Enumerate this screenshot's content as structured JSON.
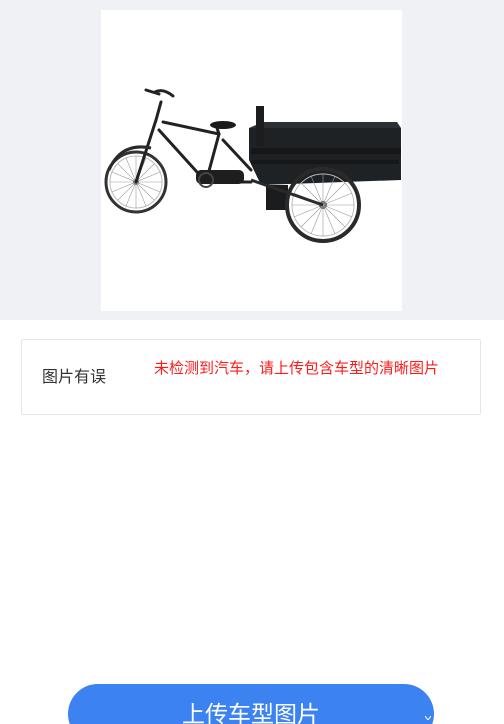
{
  "result": {
    "label": "图片有误",
    "message": "未检测到汽车，请上传包含车型的清晰图片"
  },
  "upload": {
    "button_label": "上传车型图片"
  },
  "colors": {
    "accent": "#3c82f0",
    "error": "#ff1a1a",
    "preview_background": "#f0f1f5"
  },
  "preview": {
    "image_subject": "cargo-tricycle-photo"
  }
}
